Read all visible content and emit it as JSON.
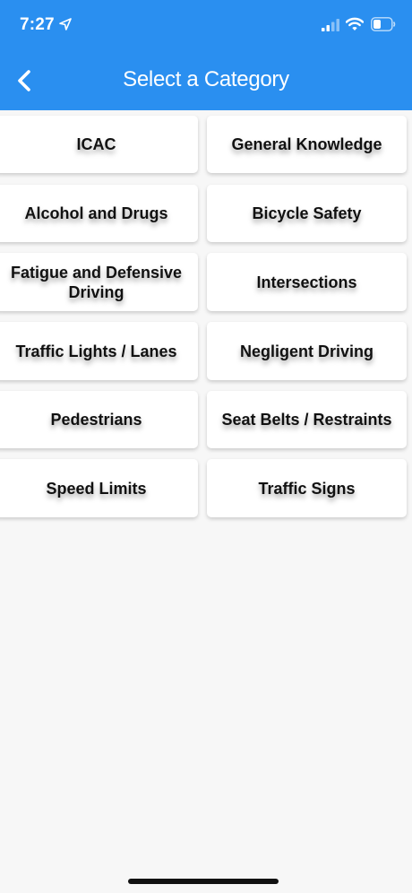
{
  "status_bar": {
    "time": "7:27",
    "icons": [
      "location-arrow-icon",
      "cellular-signal-icon",
      "wifi-icon",
      "battery-icon"
    ]
  },
  "nav": {
    "title": "Select a Category",
    "back_icon": "chevron-left-icon"
  },
  "colors": {
    "header": "#2a8ff0",
    "background": "#f7f7f7",
    "card": "#ffffff",
    "text": "#111111"
  },
  "categories": [
    "ICAC",
    "General Knowledge",
    "Alcohol and Drugs",
    "Bicycle Safety",
    "Fatigue and Defensive Driving",
    "Intersections",
    "Traffic Lights / Lanes",
    "Negligent Driving",
    "Pedestrians",
    "Seat Belts / Restraints",
    "Speed Limits",
    "Traffic Signs"
  ]
}
